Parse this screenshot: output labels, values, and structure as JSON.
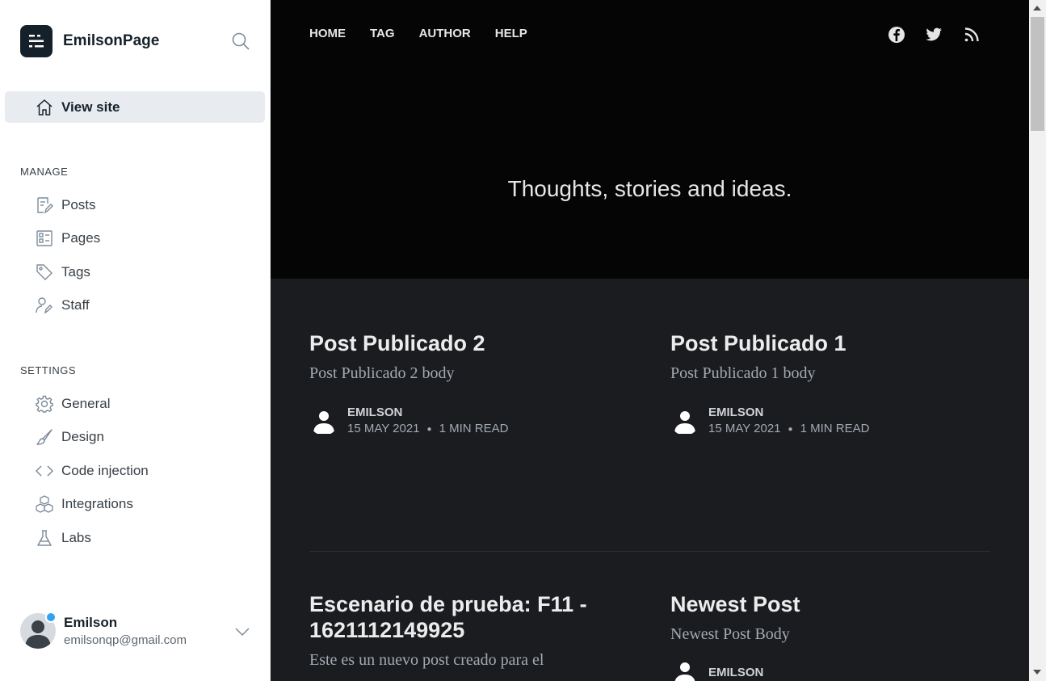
{
  "sidebar": {
    "brand_name": "EmilsonPage",
    "view_site_label": "View site",
    "manage_title": "MANAGE",
    "manage_items": [
      {
        "label": "Posts",
        "icon": "posts-icon"
      },
      {
        "label": "Pages",
        "icon": "pages-icon"
      },
      {
        "label": "Tags",
        "icon": "tag-icon"
      },
      {
        "label": "Staff",
        "icon": "staff-icon"
      }
    ],
    "settings_title": "SETTINGS",
    "settings_items": [
      {
        "label": "General",
        "icon": "gear-icon"
      },
      {
        "label": "Design",
        "icon": "brush-icon"
      },
      {
        "label": "Code injection",
        "icon": "code-icon"
      },
      {
        "label": "Integrations",
        "icon": "integrations-icon"
      },
      {
        "label": "Labs",
        "icon": "flask-icon"
      }
    ],
    "user": {
      "name": "Emilson",
      "email": "emilsonqp@gmail.com"
    }
  },
  "site": {
    "nav": [
      "HOME",
      "TAG",
      "AUTHOR",
      "HELP"
    ],
    "social": [
      "facebook-icon",
      "twitter-icon",
      "rss-icon"
    ],
    "tagline": "Thoughts, stories and ideas.",
    "posts": [
      {
        "title": "Post Publicado 2",
        "excerpt": "Post Publicado 2 body",
        "author": "EMILSON",
        "date": "15 MAY 2021",
        "read": "1 MIN READ"
      },
      {
        "title": "Post Publicado 1",
        "excerpt": "Post Publicado 1 body",
        "author": "EMILSON",
        "date": "15 MAY 2021",
        "read": "1 MIN READ"
      },
      {
        "title": "Escenario de prueba: F11 - 1621112149925",
        "excerpt": "Este es un nuevo post creado para el",
        "author": "",
        "date": "",
        "read": ""
      },
      {
        "title": "Newest Post",
        "excerpt": "Newest Post Body",
        "author": "EMILSON",
        "date": "",
        "read": ""
      }
    ]
  },
  "colors": {
    "accent": "#30a3f0",
    "hero_bg": "#050505",
    "content_bg": "#1b1c20",
    "sidebar_active": "#e8ecf1"
  }
}
